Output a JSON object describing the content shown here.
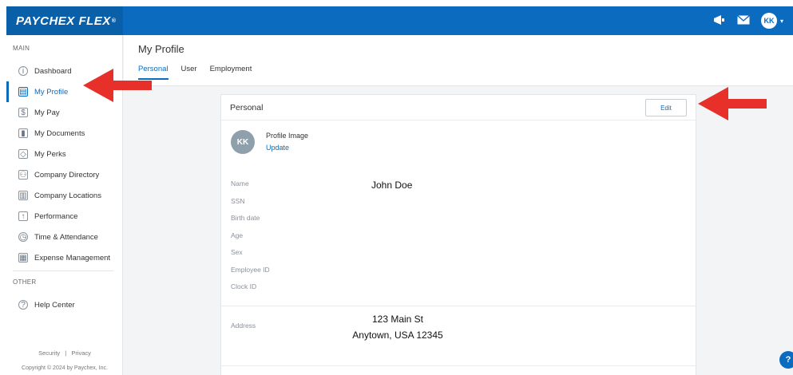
{
  "app": {
    "brand": "PAYCHEX FLEX",
    "trademark": "®"
  },
  "topbar": {
    "megaphone_icon": "megaphone-icon",
    "mail_icon": "mail-icon",
    "avatar_initials": "KK"
  },
  "sidebar": {
    "main_heading": "MAIN",
    "items": [
      {
        "label": "Dashboard",
        "icon": "info-icon",
        "glyph": "i"
      },
      {
        "label": "My Profile",
        "icon": "id-card-icon",
        "glyph": "▤"
      },
      {
        "label": "My Pay",
        "icon": "pay-icon",
        "glyph": "$"
      },
      {
        "label": "My Documents",
        "icon": "documents-icon",
        "glyph": "▮"
      },
      {
        "label": "My Perks",
        "icon": "tag-icon",
        "glyph": "◇"
      },
      {
        "label": "Company Directory",
        "icon": "people-icon",
        "glyph": "⚇"
      },
      {
        "label": "Company Locations",
        "icon": "building-icon",
        "glyph": "▥"
      },
      {
        "label": "Performance",
        "icon": "performance-icon",
        "glyph": "↑"
      },
      {
        "label": "Time & Attendance",
        "icon": "clock-icon",
        "glyph": "◷"
      },
      {
        "label": "Expense Management",
        "icon": "expense-icon",
        "glyph": "▦"
      }
    ],
    "active_index": 1,
    "other_heading": "OTHER",
    "help": {
      "label": "Help Center",
      "icon": "question-icon",
      "glyph": "?"
    },
    "footer_security": "Security",
    "footer_separator": "|",
    "footer_privacy": "Privacy",
    "copyright": "Copyright © 2024 by Paychex, Inc."
  },
  "header": {
    "title": "My Profile",
    "tabs": [
      {
        "label": "Personal"
      },
      {
        "label": "User"
      },
      {
        "label": "Employment"
      }
    ]
  },
  "card": {
    "title": "Personal",
    "edit_label": "Edit",
    "avatar_initials": "KK",
    "profile_image_label": "Profile Image",
    "update_label": "Update",
    "fields": [
      {
        "label": "Name"
      },
      {
        "label": "SSN"
      },
      {
        "label": "Birth date"
      },
      {
        "label": "Age"
      },
      {
        "label": "Sex"
      },
      {
        "label": "Employee ID"
      },
      {
        "label": "Clock ID"
      }
    ],
    "name_value": "John Doe",
    "address_label": "Address",
    "address_line1": "123 Main St",
    "address_line2": "Anytown, USA 12345"
  },
  "help_fab": "?",
  "colors": {
    "brand_blue": "#0b6bbf",
    "arrow_red": "#e8302a"
  }
}
